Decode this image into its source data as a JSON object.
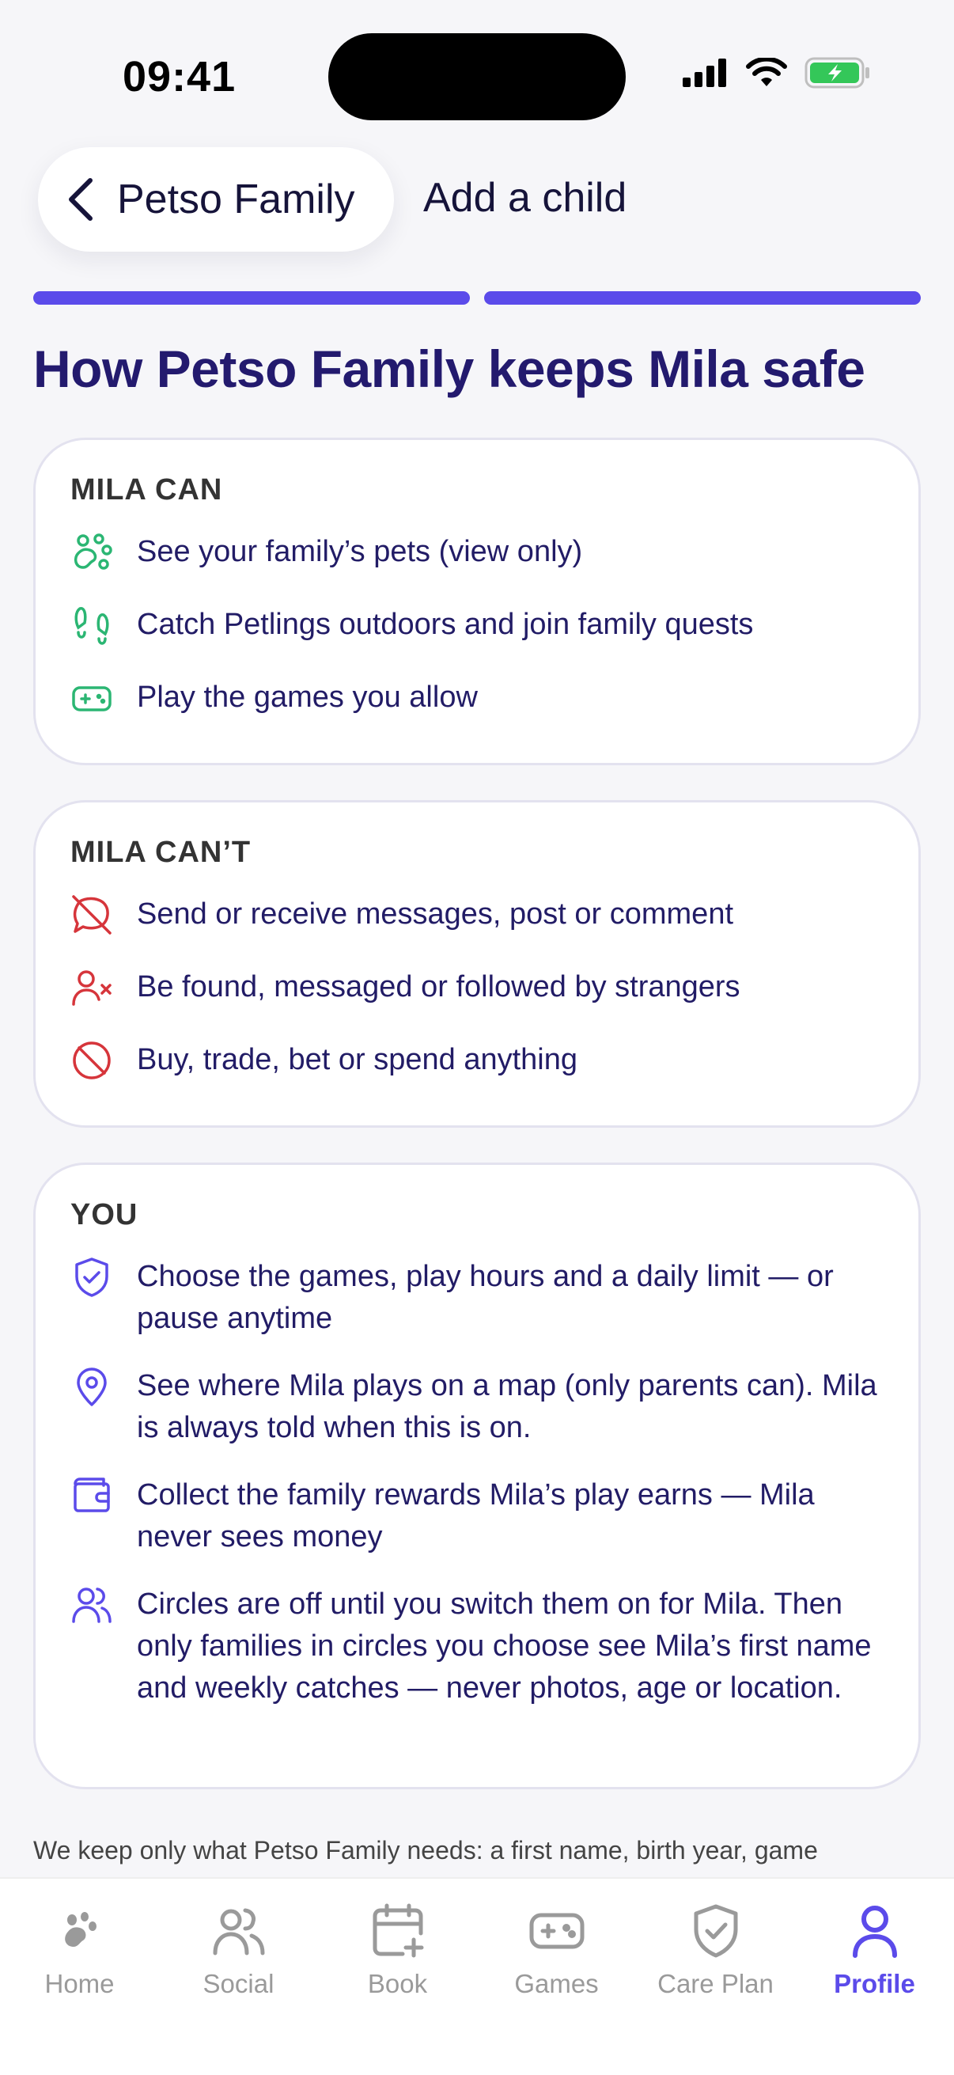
{
  "status_bar": {
    "time": "09:41"
  },
  "header": {
    "back_label": "Petso Family",
    "title": "Add a child"
  },
  "progress": {
    "steps_total": 2,
    "steps_done": 2
  },
  "page_title": "How Petso Family keeps Mila safe",
  "can_card": {
    "title": "MILA CAN",
    "items": [
      {
        "icon": "paw-icon",
        "text": "See your family’s pets (view only)"
      },
      {
        "icon": "footprints-icon",
        "text": "Catch Petlings outdoors and join family quests"
      },
      {
        "icon": "gamepad-icon",
        "text": "Play the games you allow"
      }
    ]
  },
  "cant_card": {
    "title": "MILA CAN’T",
    "items": [
      {
        "icon": "message-off-icon",
        "text": "Send or receive messages, post or comment"
      },
      {
        "icon": "user-x-icon",
        "text": "Be found, messaged or followed by strangers"
      },
      {
        "icon": "ban-icon",
        "text": "Buy, trade, bet or spend anything"
      }
    ]
  },
  "you_card": {
    "title": "YOU",
    "items": [
      {
        "icon": "shield-check-icon",
        "text": "Choose the games, play hours and a daily limit — or pause anytime"
      },
      {
        "icon": "map-pin-icon",
        "text": "See where Mila plays on a map (only parents can). Mila is always told when this is on."
      },
      {
        "icon": "wallet-icon",
        "text": "Collect the family rewards Mila’s play earns — Mila never sees money"
      },
      {
        "icon": "users-icon",
        "text": "Circles are off until you switch them on for Mila. Then only families in circles you choose see Mila’s first name and weekly catches — never photos, age or location."
      }
    ]
  },
  "footer_text": "We keep only what Petso Family needs: a first name, birth year, game",
  "tabs": [
    {
      "label": "Home",
      "icon": "paw-icon"
    },
    {
      "label": "Social",
      "icon": "users-icon"
    },
    {
      "label": "Book",
      "icon": "calendar-plus-icon"
    },
    {
      "label": "Games",
      "icon": "gamepad-icon"
    },
    {
      "label": "Care Plan",
      "icon": "shield-check-icon"
    },
    {
      "label": "Profile",
      "icon": "user-icon",
      "active": true
    }
  ],
  "colors": {
    "accent": "#5b4bea",
    "title": "#231a6e",
    "can_green": "#2bb673",
    "cant_red": "#d6353b",
    "you_purple": "#5b4bea",
    "tab_inactive": "#9a9a9a"
  }
}
